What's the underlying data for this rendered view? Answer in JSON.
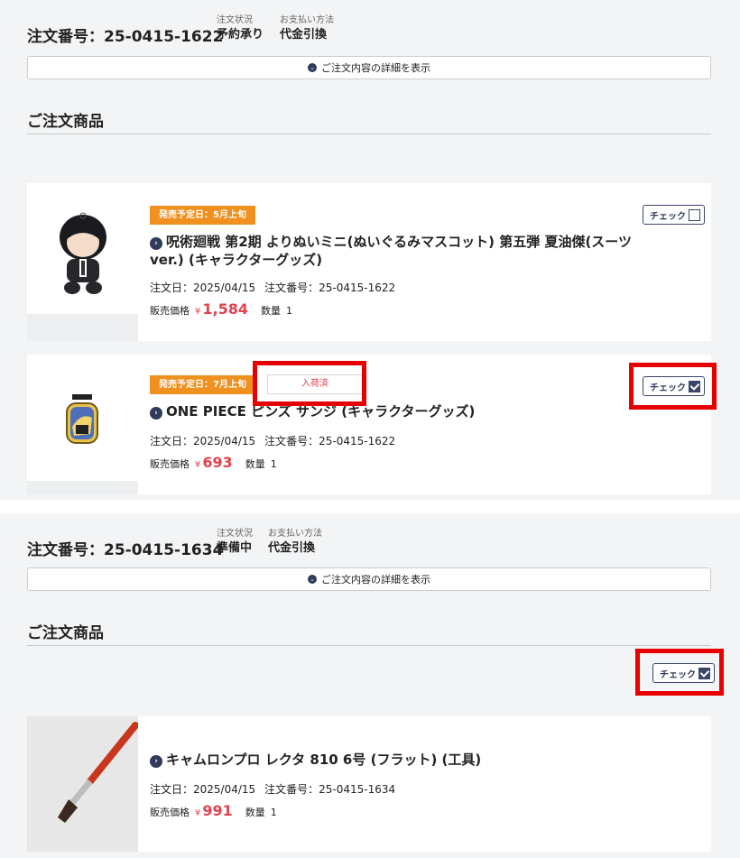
{
  "orders": [
    {
      "order_no": "注文番号：25-0415-1622",
      "status_label": "注文状況",
      "status_value": "予約承り",
      "payment_label": "お支払い方法",
      "payment_value": "代金引換",
      "detail_button": "ご注文内容の詳細を表示",
      "section_title": "ご注文商品",
      "items": [
        {
          "release_badge": "発売予定日：5月上旬",
          "name": "呪術廻戦 第2期 よりぬいミニ(ぬいぐるみマスコット) 第五弾 夏油傑(スーツver.) (キャラクターグッズ)",
          "order_date": "注文日：2025/04/15",
          "order_no": "注文番号：25-0415-1622",
          "price_label": "販売価格",
          "price_currency": "¥",
          "price": "1,584",
          "qty_label": "数量",
          "qty": "1",
          "check_label": "チェック",
          "checked": false
        },
        {
          "release_badge": "発売予定日：7月上旬",
          "arrival_badge": "入荷済",
          "name": "ONE PIECE ピンズ サンジ (キャラクターグッズ)",
          "order_date": "注文日：2025/04/15",
          "order_no": "注文番号：25-0415-1622",
          "price_label": "販売価格",
          "price_currency": "¥",
          "price": "693",
          "qty_label": "数量",
          "qty": "1",
          "check_label": "チェック",
          "checked": true
        }
      ]
    },
    {
      "order_no": "注文番号：25-0415-1634",
      "status_label": "注文状況",
      "status_value": "準備中",
      "payment_label": "お支払い方法",
      "payment_value": "代金引換",
      "detail_button": "ご注文内容の詳細を表示",
      "section_title": "ご注文商品",
      "check_label": "チェック",
      "checked": true,
      "items": [
        {
          "name": "キャムロンプロ レクタ 810 6号 (フラット) (工具)",
          "order_date": "注文日：2025/04/15",
          "order_no": "注文番号：25-0415-1634",
          "price_label": "販売価格",
          "price_currency": "¥",
          "price": "991",
          "qty_label": "数量",
          "qty": "1"
        }
      ]
    }
  ],
  "colors": {
    "accent_orange": "#f0901e",
    "price_red": "#e0434f",
    "navy": "#2f3a5c",
    "highlight_red": "#e60000"
  }
}
